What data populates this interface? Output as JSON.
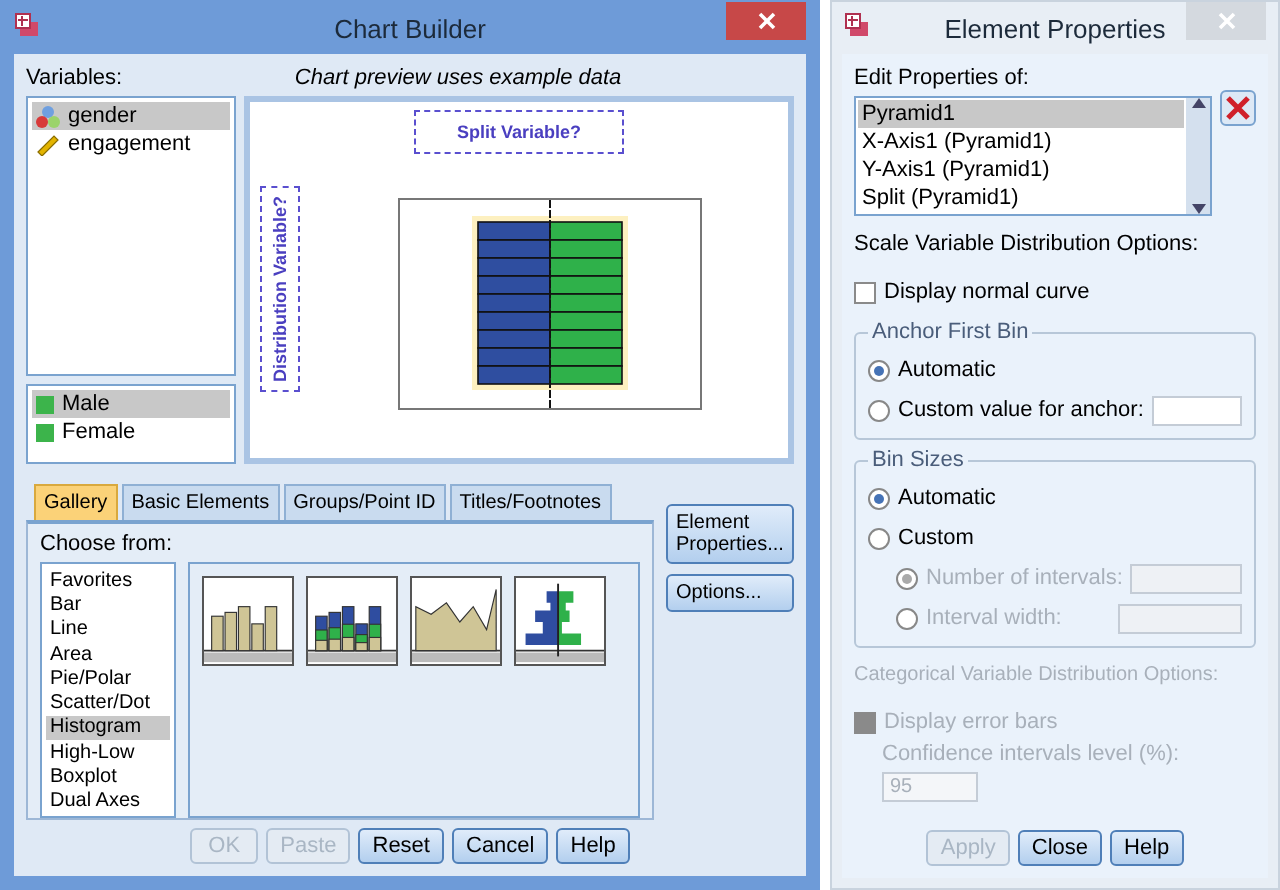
{
  "chart_builder": {
    "title": "Chart Builder",
    "variables_label": "Variables:",
    "preview_caption": "Chart preview uses example data",
    "variables": [
      {
        "name": "gender",
        "kind": "nominal",
        "selected": true
      },
      {
        "name": "engagement",
        "kind": "scale",
        "selected": false
      }
    ],
    "categories": [
      {
        "label": "Male",
        "selected": true,
        "color": "#3cb44b"
      },
      {
        "label": "Female",
        "selected": false,
        "color": "#3cb44b"
      }
    ],
    "split_placeholder": "Split Variable?",
    "distribution_placeholder": "Distribution Variable?",
    "tabs": [
      {
        "label": "Gallery",
        "selected": true
      },
      {
        "label": "Basic Elements",
        "selected": false
      },
      {
        "label": "Groups/Point ID",
        "selected": false
      },
      {
        "label": "Titles/Footnotes",
        "selected": false
      }
    ],
    "choose_label": "Choose from:",
    "chart_types": [
      {
        "label": "Favorites",
        "selected": false
      },
      {
        "label": "Bar",
        "selected": false
      },
      {
        "label": "Line",
        "selected": false
      },
      {
        "label": "Area",
        "selected": false
      },
      {
        "label": "Pie/Polar",
        "selected": false
      },
      {
        "label": "Scatter/Dot",
        "selected": false
      },
      {
        "label": "Histogram",
        "selected": true
      },
      {
        "label": "High-Low",
        "selected": false
      },
      {
        "label": "Boxplot",
        "selected": false
      },
      {
        "label": "Dual Axes",
        "selected": false
      }
    ],
    "gallery": [
      {
        "kind": "bar"
      },
      {
        "kind": "stacked"
      },
      {
        "kind": "area"
      },
      {
        "kind": "pyramid"
      }
    ],
    "side_buttons": [
      "Element Properties...",
      "Options..."
    ],
    "buttons": [
      {
        "label": "OK",
        "disabled": true
      },
      {
        "label": "Paste",
        "disabled": true
      },
      {
        "label": "Reset",
        "disabled": false
      },
      {
        "label": "Cancel",
        "disabled": false
      },
      {
        "label": "Help",
        "disabled": false
      }
    ]
  },
  "element_properties": {
    "title": "Element Properties",
    "edit_label": "Edit Properties of:",
    "elements": [
      {
        "label": "Pyramid1",
        "selected": true
      },
      {
        "label": "X-Axis1 (Pyramid1)",
        "selected": false
      },
      {
        "label": "Y-Axis1 (Pyramid1)",
        "selected": false
      },
      {
        "label": "Split (Pyramid1)",
        "selected": false
      }
    ],
    "scale_heading": "Scale Variable Distribution Options:",
    "normal_curve": {
      "label": "Display normal curve",
      "checked": false
    },
    "anchor": {
      "title": "Anchor First Bin",
      "options": [
        {
          "label": "Automatic",
          "selected": true
        },
        {
          "label": "Custom value for anchor:",
          "selected": false
        }
      ]
    },
    "bin_sizes": {
      "title": "Bin Sizes",
      "options": [
        {
          "label": "Automatic",
          "selected": true
        },
        {
          "label": "Custom",
          "selected": false
        }
      ],
      "sub_options": [
        {
          "label": "Number of intervals:",
          "selected": true
        },
        {
          "label": "Interval width:",
          "selected": false
        }
      ],
      "sub_disabled": true
    },
    "categorical_heading": "Categorical Variable Distribution Options:",
    "error_bars": {
      "label": "Display error bars",
      "checked": true,
      "disabled": true
    },
    "confidence_label": "Confidence intervals level (%):",
    "confidence_value": "95",
    "buttons": [
      {
        "label": "Apply",
        "disabled": true
      },
      {
        "label": "Close",
        "disabled": false
      },
      {
        "label": "Help",
        "disabled": false
      }
    ]
  }
}
